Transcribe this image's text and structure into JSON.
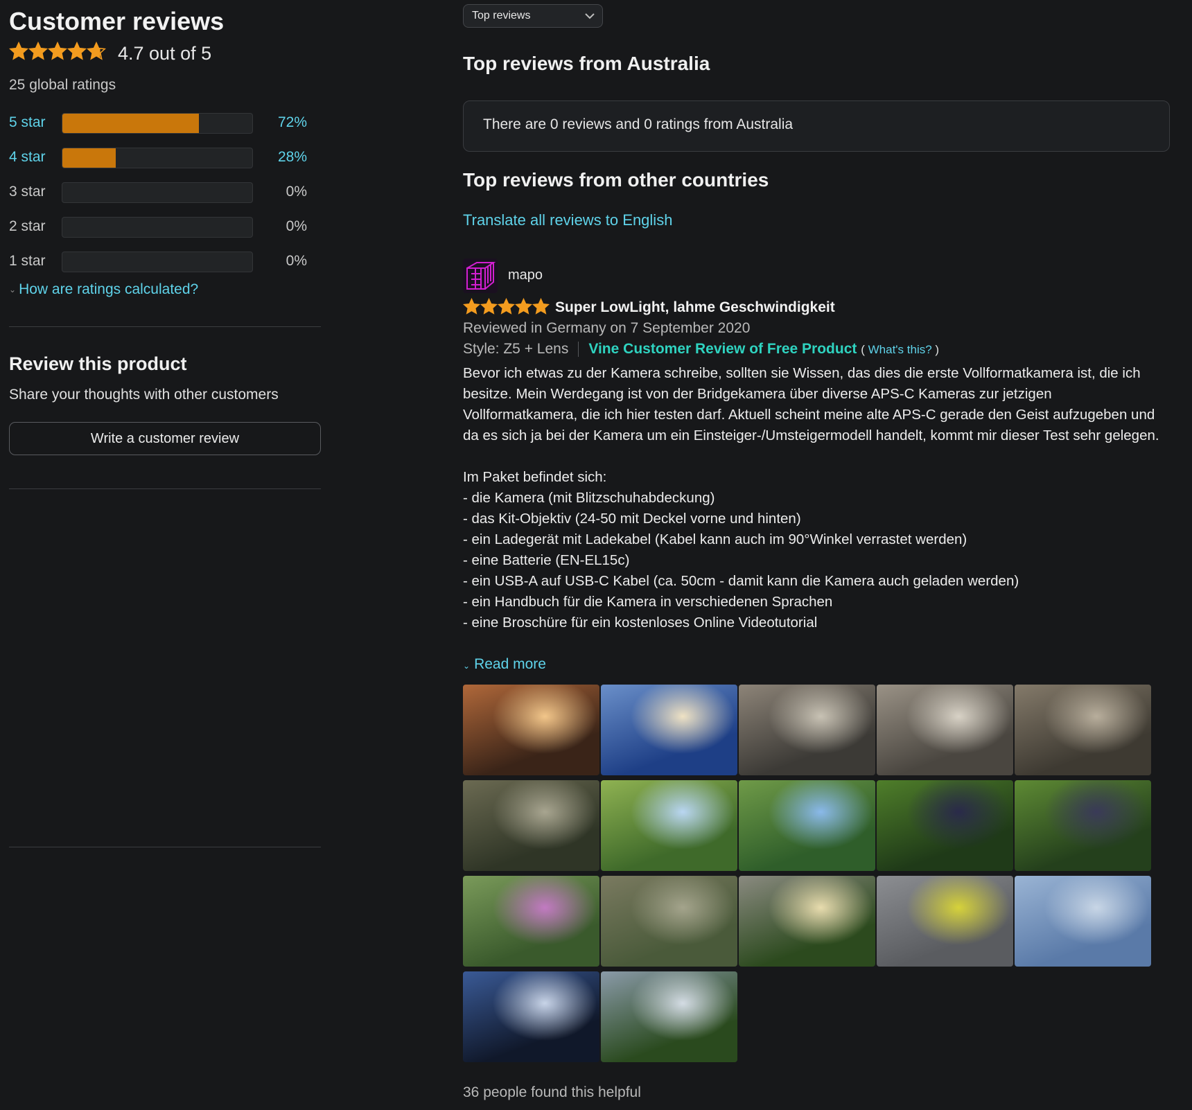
{
  "summary": {
    "title": "Customer reviews",
    "rating_value": 4.7,
    "rating_text": "4.7 out of 5",
    "global_ratings": "25 global ratings",
    "histogram": [
      {
        "label": "5 star",
        "percent": 72,
        "percent_text": "72%",
        "link": true
      },
      {
        "label": "4 star",
        "percent": 28,
        "percent_text": "28%",
        "link": true
      },
      {
        "label": "3 star",
        "percent": 0,
        "percent_text": "0%",
        "link": false
      },
      {
        "label": "2 star",
        "percent": 0,
        "percent_text": "0%",
        "link": false
      },
      {
        "label": "1 star",
        "percent": 0,
        "percent_text": "0%",
        "link": false
      }
    ],
    "how_calculated": "How are ratings calculated?"
  },
  "review_product": {
    "title": "Review this product",
    "subtitle": "Share your thoughts with other customers",
    "button": "Write a customer review"
  },
  "sort": {
    "selected": "Top reviews"
  },
  "australia": {
    "heading": "Top reviews from Australia",
    "notice": "There are 0 reviews and 0 ratings from Australia"
  },
  "other": {
    "heading": "Top reviews from other countries",
    "translate": "Translate all reviews to English"
  },
  "review": {
    "author": "mapo",
    "stars": 5,
    "title": "Super LowLight, lahme Geschwindigkeit",
    "date": "Reviewed in Germany on 7 September 2020",
    "style": "Style: Z5 + Lens",
    "vine": "Vine Customer Review of Free Product",
    "whats_this": "What's this?",
    "paragraph1": "Bevor ich etwas zu der Kamera schreibe, sollten sie Wissen, das dies die erste Vollformatkamera ist, die ich besitze. Mein Werdegang ist von der Bridgekamera über diverse APS-C Kameras zur jetzigen Vollformatkamera, die ich hier testen darf. Aktuell scheint meine alte APS-C gerade den Geist aufzugeben und da es sich ja bei der Kamera um ein Einsteiger-/Umsteigermodell handelt, kommt mir dieser Test sehr gelegen.",
    "list_intro": "Im Paket befindet sich:",
    "list": [
      "- die Kamera (mit Blitzschuhabdeckung)",
      "- das Kit-Objektiv (24-50 mit Deckel vorne und hinten)",
      "- ein Ladegerät mit Ladekabel (Kabel kann auch im 90°Winkel verrastet werden)",
      "- eine Batterie (EN-EL15c)",
      "- ein USB-A auf USB-C Kabel (ca. 50cm - damit kann die Kamera auch geladen werden)",
      "- ein Handbuch für die Kamera in verschiedenen Sprachen",
      "- eine Broschüre für ein kostenloses Online Videotutorial"
    ],
    "read_more": "Read more",
    "helpful": "36 people found this helpful",
    "photos": [
      {
        "name": "candle-on-wood-photo",
        "colors": [
          "#3a2418",
          "#b0683a",
          "#f2c68a"
        ]
      },
      {
        "name": "cloudy-sky-photo",
        "colors": [
          "#1e3f86",
          "#6a8fc9",
          "#efe2c4"
        ]
      },
      {
        "name": "rocky-stream-photo",
        "colors": [
          "#3c3a36",
          "#8d8478",
          "#c8c2b4"
        ]
      },
      {
        "name": "stone-cairn-photo",
        "colors": [
          "#4a4640",
          "#9a9286",
          "#d8d2c6"
        ]
      },
      {
        "name": "creek-bed-photo",
        "colors": [
          "#3e3a32",
          "#847a6a",
          "#b8ae9c"
        ]
      },
      {
        "name": "mossy-rocks-photo",
        "colors": [
          "#2f3526",
          "#6b6a52",
          "#a8a590"
        ]
      },
      {
        "name": "vineyard-row-photo",
        "colors": [
          "#3f6a2a",
          "#8fb252",
          "#b9d6f2"
        ]
      },
      {
        "name": "vineyard-hill-photo",
        "colors": [
          "#2f5e2a",
          "#6f9a48",
          "#8ab9ea"
        ]
      },
      {
        "name": "grapes-photo",
        "colors": [
          "#1f3a18",
          "#4f7e2a",
          "#2a2a4a"
        ]
      },
      {
        "name": "grape-vines-photo",
        "colors": [
          "#24401c",
          "#5e8a34",
          "#3a3a58"
        ]
      },
      {
        "name": "pink-flowers-photo",
        "colors": [
          "#3a5a2c",
          "#7a9a5a",
          "#c27ac2"
        ]
      },
      {
        "name": "river-bird-photo",
        "colors": [
          "#4a5a3a",
          "#7a7a60",
          "#a4a48c"
        ]
      },
      {
        "name": "concrete-frame-photo",
        "colors": [
          "#2c4a1e",
          "#8a8a80",
          "#e8dcae"
        ]
      },
      {
        "name": "camera-strap-photo",
        "colors": [
          "#5a5c60",
          "#8c8e92",
          "#d6d23a"
        ]
      },
      {
        "name": "building-facade-photo",
        "colors": [
          "#5a7aa8",
          "#9ab4d4",
          "#c8d6e6"
        ]
      },
      {
        "name": "fountain-photo",
        "colors": [
          "#10182a",
          "#3a5a96",
          "#c8d4e8"
        ]
      },
      {
        "name": "shrub-pot-photo",
        "colors": [
          "#2a4a1e",
          "#8a9aa8",
          "#d4dce4"
        ]
      }
    ]
  },
  "colors": {
    "background": "#17181a",
    "link": "#5fd3ea",
    "star": "#f39c1f",
    "bar_fill": "#c9770b",
    "vine": "#2fd3c0"
  }
}
